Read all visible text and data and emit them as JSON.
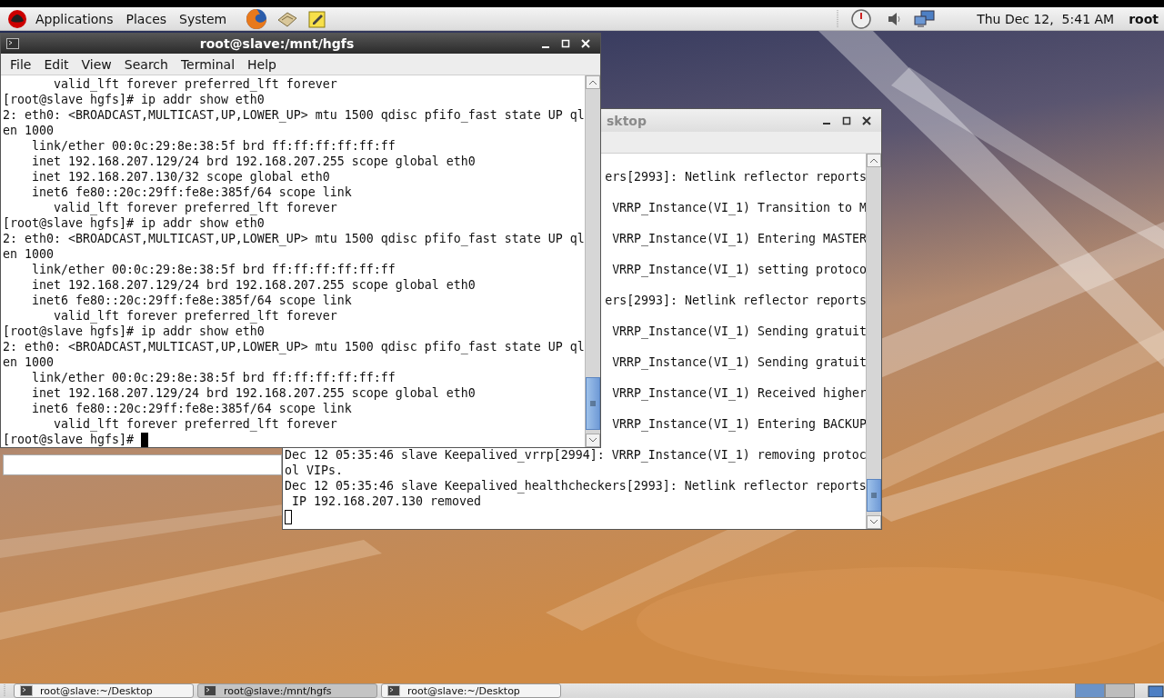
{
  "top_panel": {
    "menus": [
      {
        "label": "Applications"
      },
      {
        "label": "Places"
      },
      {
        "label": "System"
      }
    ],
    "clock": "Thu Dec 12,  5:41 AM",
    "user": "root"
  },
  "windows": [
    {
      "focused": true,
      "title": "root@slave:/mnt/hgfs",
      "menus": [
        "File",
        "Edit",
        "View",
        "Search",
        "Terminal",
        "Help"
      ],
      "lines": [
        {
          "kind": "full",
          "text": "       valid_lft forever preferred_lft forever"
        },
        {
          "kind": "full",
          "text": "[root@slave hgfs]# ip addr show eth0"
        },
        {
          "kind": "full",
          "text": "2: eth0: <BROADCAST,MULTICAST,UP,LOWER_UP> mtu 1500 qdisc pfifo_fast state UP ql"
        },
        {
          "kind": "full",
          "text": "en 1000"
        },
        {
          "kind": "full",
          "text": "    link/ether 00:0c:29:8e:38:5f brd ff:ff:ff:ff:ff:ff"
        },
        {
          "kind": "full",
          "text": "    inet 192.168.207.129/24 brd 192.168.207.255 scope global eth0"
        },
        {
          "kind": "full",
          "text": "    inet 192.168.207.130/32 scope global eth0"
        },
        {
          "kind": "full",
          "text": "    inet6 fe80::20c:29ff:fe8e:385f/64 scope link"
        },
        {
          "kind": "full",
          "text": "       valid_lft forever preferred_lft forever"
        },
        {
          "kind": "full",
          "text": "[root@slave hgfs]# ip addr show eth0"
        },
        {
          "kind": "full",
          "text": "2: eth0: <BROADCAST,MULTICAST,UP,LOWER_UP> mtu 1500 qdisc pfifo_fast state UP ql"
        },
        {
          "kind": "full",
          "text": "en 1000"
        },
        {
          "kind": "full",
          "text": "    link/ether 00:0c:29:8e:38:5f brd ff:ff:ff:ff:ff:ff"
        },
        {
          "kind": "full",
          "text": "    inet 192.168.207.129/24 brd 192.168.207.255 scope global eth0"
        },
        {
          "kind": "full",
          "text": "    inet6 fe80::20c:29ff:fe8e:385f/64 scope link"
        },
        {
          "kind": "full",
          "text": "       valid_lft forever preferred_lft forever"
        },
        {
          "kind": "full",
          "text": "[root@slave hgfs]# ip addr show eth0"
        },
        {
          "kind": "full",
          "text": "2: eth0: <BROADCAST,MULTICAST,UP,LOWER_UP> mtu 1500 qdisc pfifo_fast state UP ql"
        },
        {
          "kind": "full",
          "text": "en 1000"
        },
        {
          "kind": "full",
          "text": "    link/ether 00:0c:29:8e:38:5f brd ff:ff:ff:ff:ff:ff"
        },
        {
          "kind": "full",
          "text": "    inet 192.168.207.129/24 brd 192.168.207.255 scope global eth0"
        },
        {
          "kind": "full",
          "text": "    inet6 fe80::20c:29ff:fe8e:385f/64 scope link"
        },
        {
          "kind": "full",
          "text": "       valid_lft forever preferred_lft forever"
        }
      ],
      "prompt": "[root@slave hgfs]#"
    },
    {
      "focused": false,
      "title": "sktop",
      "lines": [
        {
          "kind": "tail",
          "text": "ers[2993]: Netlink reflector reports"
        },
        {
          "kind": "tail",
          "text": "VRRP_Instance(VI_1) Transition to M"
        },
        {
          "kind": "tail",
          "text": "VRRP_Instance(VI_1) Entering MASTER"
        },
        {
          "kind": "tail",
          "text": "VRRP_Instance(VI_1) setting protoco"
        },
        {
          "kind": "tail",
          "text": "ers[2993]: Netlink reflector reports"
        },
        {
          "kind": "tail",
          "text": "VRRP_Instance(VI_1) Sending gratuit"
        },
        {
          "kind": "tail",
          "text": "VRRP_Instance(VI_1) Sending gratuit"
        },
        {
          "kind": "tail",
          "text": "VRRP_Instance(VI_1) Received higher"
        },
        {
          "kind": "tail",
          "text": "VRRP_Instance(VI_1) Entering BACKUP"
        },
        {
          "kind": "full",
          "text": "Dec 12 05:35:46 slave Keepalived_vrrp[2994]: VRRP_Instance(VI_1) removing protoc"
        },
        {
          "kind": "full",
          "text": "ol VIPs."
        },
        {
          "kind": "full",
          "text": "Dec 12 05:35:46 slave Keepalived_healthcheckers[2993]: Netlink reflector reports"
        },
        {
          "kind": "full",
          "text": " IP 192.168.207.130 removed"
        }
      ]
    }
  ],
  "taskbar": {
    "tasks": [
      {
        "label": "root@slave:~/Desktop",
        "selected": false
      },
      {
        "label": "root@slave:/mnt/hgfs",
        "selected": true
      },
      {
        "label": "root@slave:~/Desktop",
        "selected": false
      }
    ]
  }
}
